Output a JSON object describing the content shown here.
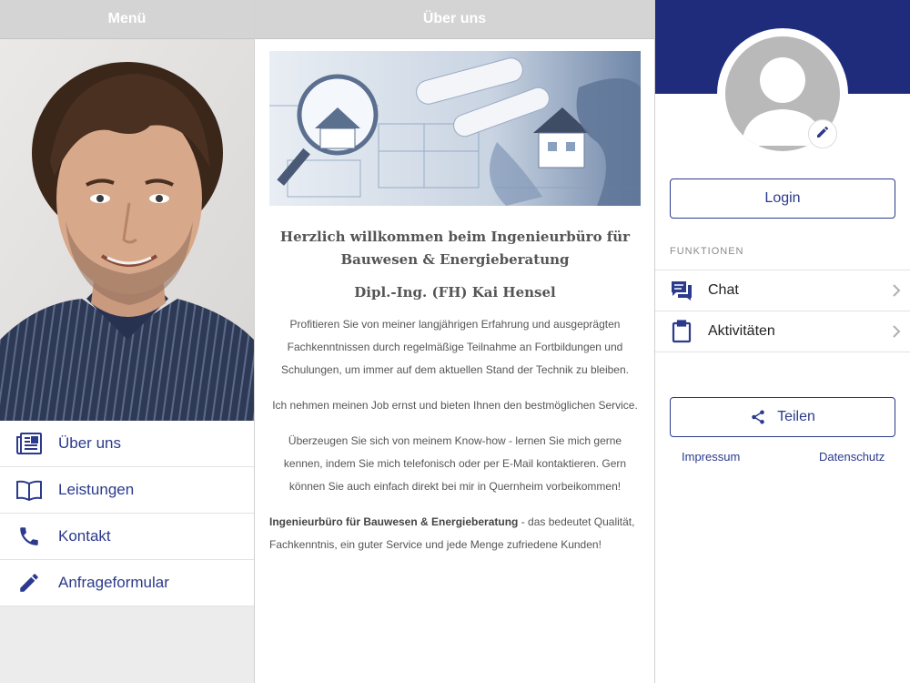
{
  "left": {
    "header": "Menü",
    "menu": [
      {
        "label": "Über uns",
        "icon": "newspaper-icon"
      },
      {
        "label": "Leistungen",
        "icon": "book-icon"
      },
      {
        "label": "Kontakt",
        "icon": "phone-icon"
      },
      {
        "label": "Anfrageformular",
        "icon": "pencil-icon"
      }
    ]
  },
  "middle": {
    "header": "Über uns",
    "welcome_line1": "Herzlich willkommen beim Ingenieurbüro für",
    "welcome_line2": "Bauwesen & Energieberatung",
    "engineer": "Dipl.-Ing. (FH) Kai Hensel",
    "para1": "Profitieren Sie von meiner langjährigen Erfahrung und ausgeprägten Fachkenntnissen durch regelmäßige Teilnahme an Fortbildungen und Schulungen, um immer auf dem aktuellen Stand der Technik zu bleiben.",
    "para2": "Ich nehmen meinen Job ernst und bieten Ihnen den bestmöglichen Service.",
    "para3": "Überzeugen Sie sich von meinem Know-how - lernen Sie mich gerne kennen, indem Sie mich telefonisch oder per E-Mail kontaktieren. Gern können Sie auch einfach direkt bei mir in Quernheim vorbeikommen!",
    "para4_bold": "Ingenieurbüro für Bauwesen & Energieberatung",
    "para4_rest": " - das bedeutet Qualität, Fachkenntnis, ein guter Service und jede Menge zufriedene Kunden!"
  },
  "right": {
    "login_label": "Login",
    "section_label": "FUNKTIONEN",
    "functions": [
      {
        "label": "Chat",
        "icon": "chat-icon"
      },
      {
        "label": "Aktivitäten",
        "icon": "clipboard-icon"
      }
    ],
    "share_label": "Teilen",
    "impressum": "Impressum",
    "datenschutz": "Datenschutz"
  },
  "colors": {
    "accent": "#2b3a8c",
    "profile_band": "#1f2c7c",
    "header_gray": "#d4d4d4"
  }
}
